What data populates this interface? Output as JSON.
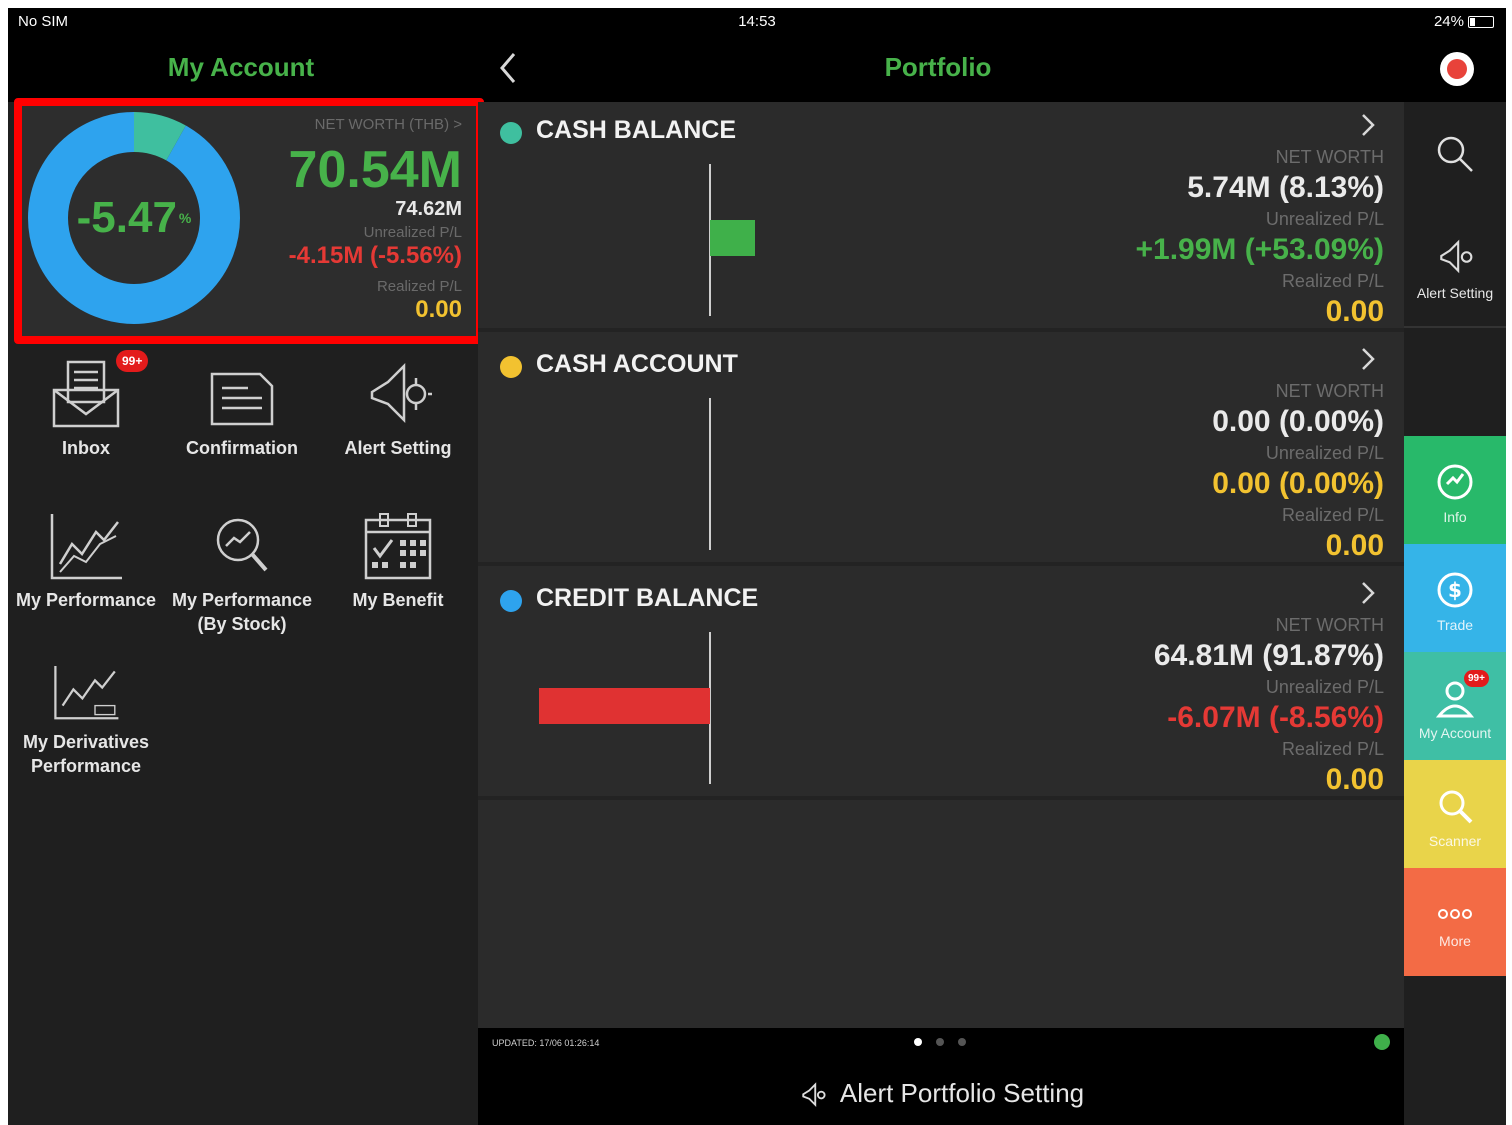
{
  "status_bar": {
    "carrier": "No SIM",
    "time": "14:53",
    "battery": "24%"
  },
  "header": {
    "left_title": "My Account",
    "center_title": "Portfolio"
  },
  "summary": {
    "donut_value": "-5.47",
    "donut_unit": "%",
    "net_worth_label": "NET WORTH (THB) >",
    "net_worth_value": "70.54M",
    "cost_value": "74.62M",
    "unrealized_label": "Unrealized P/L",
    "unrealized_value": "-4.15M (-5.56%)",
    "realized_label": "Realized P/L",
    "realized_value": "0.00",
    "donut_segments": [
      {
        "label": "Credit Balance",
        "percent": 91.87,
        "color": "#2ea3ee"
      },
      {
        "label": "Cash Balance",
        "percent": 8.13,
        "color": "#3fbf9f"
      }
    ]
  },
  "menu": {
    "items": [
      {
        "label": "Inbox",
        "badge": "99+"
      },
      {
        "label": "Confirmation"
      },
      {
        "label": "Alert Setting"
      },
      {
        "label": "My Performance"
      },
      {
        "label_line1": "My Performance",
        "label_line2": "(By Stock)"
      },
      {
        "label": "My Benefit"
      },
      {
        "label_line1": "My Derivatives",
        "label_line2": "Performance"
      }
    ]
  },
  "portfolio": {
    "sections": [
      {
        "title": "CASH BALANCE",
        "dot_color": "#3fbf9f",
        "net_worth_label": "NET WORTH",
        "net_worth": "5.74M (8.13%)",
        "unrealized_label": "Unrealized P/L",
        "unrealized": "+1.99M (+53.09%)",
        "realized_label": "Realized P/L",
        "realized": "0.00",
        "bar_value_pct": 53.09,
        "bar_color": "#3fb04a"
      },
      {
        "title": "CASH ACCOUNT",
        "dot_color": "#f2c230",
        "net_worth_label": "NET WORTH",
        "net_worth": "0.00 (0.00%)",
        "unrealized_label": "Unrealized P/L",
        "unrealized": "0.00 (0.00%)",
        "realized_label": "Realized P/L",
        "realized": "0.00",
        "bar_value_pct": 0,
        "bar_color": "#3fb04a"
      },
      {
        "title": "CREDIT BALANCE",
        "dot_color": "#2ea3ee",
        "net_worth_label": "NET WORTH",
        "net_worth": "64.81M (91.87%)",
        "unrealized_label": "Unrealized P/L",
        "unrealized": "-6.07M (-8.56%)",
        "realized_label": "Realized P/L",
        "realized": "0.00",
        "bar_value_pct": -8.56,
        "bar_color": "#e03232"
      }
    ],
    "updated": "UPDATED: 17/06 01:26:14",
    "alert_portfolio": "Alert Portfolio Setting"
  },
  "sidebar": {
    "alert_setting": "Alert Setting",
    "items": [
      {
        "label": "Info",
        "color": "#28b96a"
      },
      {
        "label": "Trade",
        "color": "#35b4e8"
      },
      {
        "label": "My Account",
        "color": "#3fbfa5",
        "badge": "99+"
      },
      {
        "label": "Scanner",
        "color": "#e9d44a"
      },
      {
        "label": "More",
        "color": "#f36b45"
      }
    ]
  },
  "colors": {
    "positive": "#47b24a",
    "negative": "#e53935",
    "neutral": "#f2c230"
  }
}
